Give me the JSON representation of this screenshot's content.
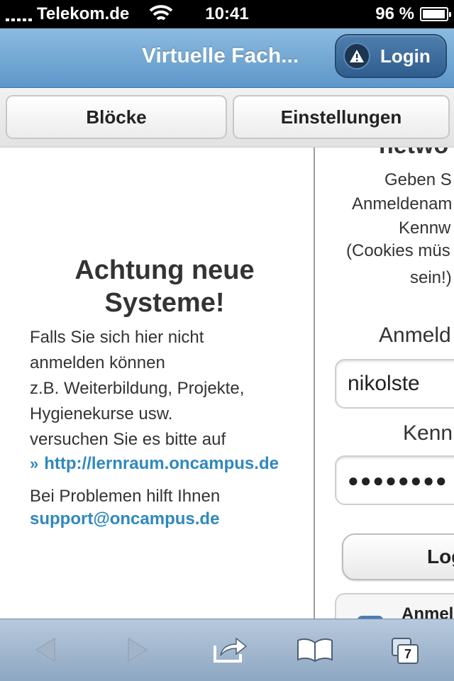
{
  "status_bar": {
    "carrier": "Telekom.de",
    "time": "10:41",
    "battery": "96 %",
    "battery_level": 0.96
  },
  "header": {
    "title": "Virtuelle Fach...",
    "login_label": "Login"
  },
  "tabs": [
    {
      "label": "Blöcke"
    },
    {
      "label": "Einstellungen"
    }
  ],
  "notice": {
    "heading": "Achtung neue Systeme!",
    "lines": [
      "Falls Sie sich hier nicht",
      "anmelden können",
      "z.B. Weiterbildung, Projekte,",
      "Hygienekurse usw.",
      "versuchen Sie es bitte auf"
    ],
    "link_prefix": "»",
    "link": "http://lernraum.oncampus.de",
    "support_text": "Bei Problemen hilft Ihnen",
    "support_mail": "support@oncampus.de"
  },
  "login_panel": {
    "heading_partial": "netwo",
    "instructions": [
      "Geben S",
      "Anmeldenam",
      "Kennw",
      "(Cookies müs",
      "sein!)"
    ],
    "username_label": "Anmeld",
    "username_value": "nikolste",
    "password_label": "Kenn",
    "password_value": "●●●●●●●●",
    "login_button": "Log",
    "remember_label": "Anmel"
  },
  "toolbar": {
    "tab_count": "7"
  },
  "colors": {
    "header": "#6fa3d1",
    "link": "#2f88c0"
  }
}
